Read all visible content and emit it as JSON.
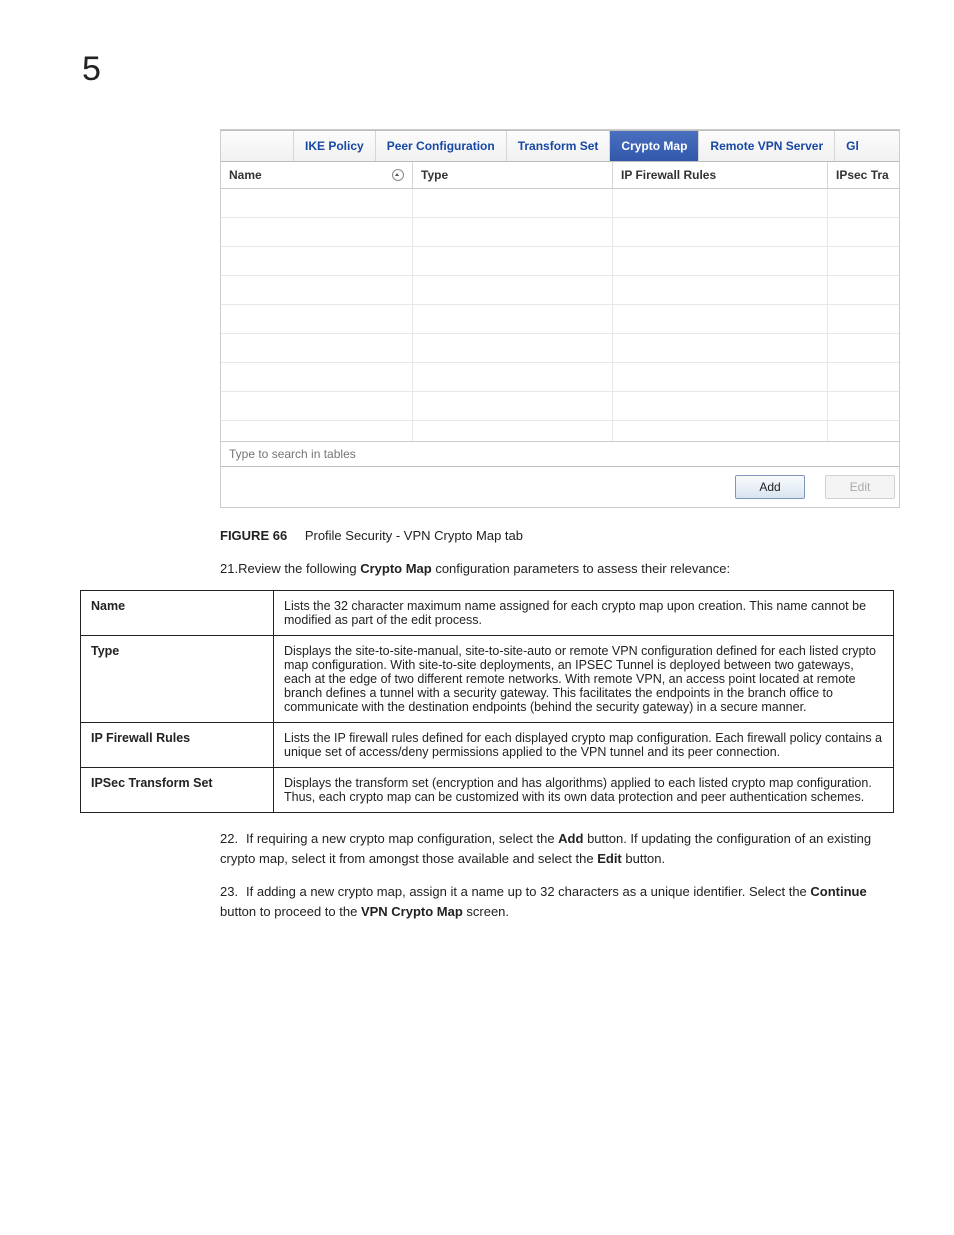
{
  "page_number": "5",
  "tabs": {
    "ike": "IKE Policy",
    "peer": "Peer Configuration",
    "transform": "Transform Set",
    "crypto": "Crypto Map",
    "remote": "Remote VPN Server",
    "global": "Gl"
  },
  "columns": {
    "name": "Name",
    "type": "Type",
    "rules": "IP Firewall Rules",
    "ipsec": "IPsec Tra"
  },
  "search_placeholder": "Type to search in tables",
  "buttons": {
    "add": "Add",
    "edit": "Edit"
  },
  "figure": {
    "label": "FIGURE 66",
    "caption": "Profile Security - VPN Crypto Map tab"
  },
  "step21": {
    "num": "21.",
    "pre": "Review the following ",
    "bold": "Crypto Map",
    "post": " configuration parameters to assess their relevance:"
  },
  "params": {
    "name": {
      "label": "Name",
      "desc": "Lists the 32 character maximum name assigned for each crypto map upon creation. This name cannot be modified as part of the edit process."
    },
    "type": {
      "label": "Type",
      "desc": "Displays the site-to-site-manual, site-to-site-auto or remote VPN configuration defined for each listed crypto map configuration. With site-to-site deployments, an IPSEC Tunnel is deployed between two gateways, each at the edge of two different remote networks. With remote VPN, an access point located at remote branch defines a tunnel with a security gateway. This facilitates the endpoints in the branch office to communicate with the destination endpoints (behind the security gateway) in a secure manner."
    },
    "rules": {
      "label": "IP Firewall Rules",
      "desc": "Lists the IP firewall rules defined for each displayed crypto map configuration. Each firewall policy contains a unique set of access/deny permissions applied to the VPN tunnel and its peer connection."
    },
    "ipsec": {
      "label": "IPSec Transform Set",
      "desc": "Displays the transform set (encryption and has algorithms) applied to each listed crypto map configuration. Thus, each crypto map can be customized with its own data protection and peer authentication schemes."
    }
  },
  "step22": {
    "num": "22.",
    "t1": "If requiring a new crypto map configuration, select the ",
    "b1": "Add",
    "t2": " button. If updating the configuration of an existing crypto map, select it from amongst those available and select the ",
    "b2": "Edit",
    "t3": " button."
  },
  "step23": {
    "num": "23.",
    "t1": "If adding a new crypto map, assign it a name up to 32 characters as a unique identifier. Select the ",
    "b1": "Continue",
    "t2": " button to proceed to the ",
    "b2": "VPN Crypto Map",
    "t3": " screen."
  }
}
